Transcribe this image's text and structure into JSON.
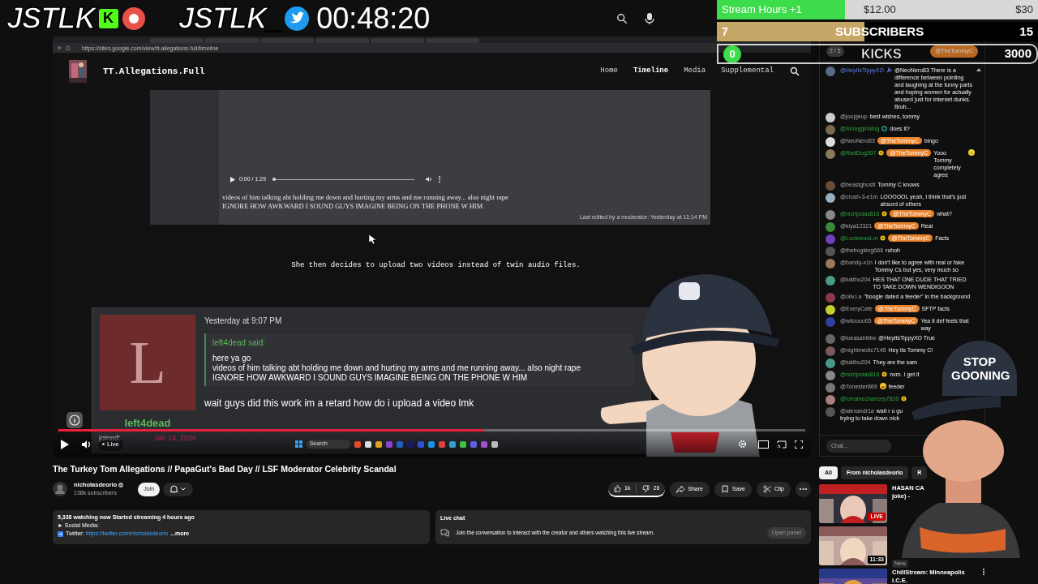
{
  "overlay": {
    "logo_1": "JSTLK",
    "kick_badge": "K",
    "logo_2": "JSTLK_",
    "timer": "00:48:20",
    "cap_text": "STOP GOONING",
    "goals": [
      {
        "kind": "bar",
        "label": "Stream Hours +1",
        "current": "$12.00",
        "target": "$30",
        "level": 0.4
      },
      {
        "kind": "count",
        "label": "SUBSCRIBERS",
        "current": "7",
        "target": "15",
        "level": 0.46
      },
      {
        "kind": "pill",
        "label": "KICKS",
        "current": "0",
        "target": "3000",
        "level": 0
      }
    ]
  },
  "browser": {
    "url": "https://sites.google.com/view/tt-allegations-full/timeline"
  },
  "site": {
    "title": "TT.Allegations.Full",
    "nav": [
      {
        "label": "Home",
        "selected": false
      },
      {
        "label": "Timeline",
        "selected": true
      },
      {
        "label": "Media",
        "selected": false
      },
      {
        "label": "Supplemental",
        "selected": false
      }
    ]
  },
  "audio_post": {
    "time": "0:00 / 1:29",
    "level": 0,
    "lines": [
      "videos of him talking abt holding me down and hurting my arms and me running away... also night rape",
      "IGNORE HOW AWKWARD I SOUND GUYS IMAGINE BEING ON THE PHONE W HIM"
    ],
    "edit_note": "Last edited by a moderator: Yesterday at 11:14 PM"
  },
  "caption": "She then decides to upload two videos instead of twin audio files.",
  "forum_post": {
    "avatar_letter": "L",
    "username": "left4dead",
    "joined_label": "joined:",
    "joined_date": "Jan 14, 2026",
    "time": "Yesterday at 9:07 PM",
    "quote_author": "left4dead said:",
    "quote_lines": [
      "here ya go",
      "videos of him talking abt holding me down and hurting my arms and me running away... also night rape",
      "IGNORE HOW AWKWARD I SOUND GUYS IMAGINE BEING ON THE PHONE W HIM"
    ],
    "reply": "wait guys did this work im a retard how do i upload a video lmk"
  },
  "player": {
    "level": 0.57,
    "live_label": "Live",
    "taskbar_search": "Search"
  },
  "video": {
    "title": "The Turkey Tom Allegations // PapaGut's Bad Day // LSF Moderator Celebrity Scandal",
    "channel": "nicholasdeorio",
    "subscribers": "138k subscribers",
    "join": "Join",
    "likes": "1k",
    "dislikes": "26",
    "actions": [
      {
        "kind": "share",
        "label": "Share"
      },
      {
        "kind": "save",
        "label": "Save"
      },
      {
        "kind": "clip",
        "label": "Clip"
      }
    ]
  },
  "description": {
    "stats": "5,338 watching now  Started streaming 4 hours ago",
    "social": "► Social Media:",
    "twitter_label": "Twitter:",
    "link": "https://twitter.com/nicholasdeorio",
    "more": "...more"
  },
  "live_chat_card": {
    "title": "Live chat",
    "text": "Join the conversation to interact with the creator and others watching this live stream.",
    "button": "Open panel"
  },
  "chat": {
    "counter": "2 / 5",
    "pinned": "@TheTommyC",
    "placeholder": "Chat...",
    "messages": [
      {
        "user": "@HeyItsTippyXO",
        "kind": "moderator",
        "badge": {
          "kind": "wrench"
        },
        "text": "@NeoNero83 There is a difference between pointing and laughing at the funny parts and hoping women for actually abused just for internet dunks. Bruh..."
      },
      {
        "user": "@joopjeup",
        "kind": "viewer",
        "text": "best wishes, tommy"
      },
      {
        "user": "@SmogginMog",
        "kind": "member",
        "badge": {
          "kind": "ring"
        },
        "text": "does it?"
      },
      {
        "user": "@NeoNero83",
        "kind": "viewer",
        "mention": "@TheTommyC",
        "text": "bingo"
      },
      {
        "user": "@RedDog307",
        "kind": "member",
        "badge": {
          "kind": "star"
        },
        "mention": "@TheTommyC",
        "text": "Yooo Tommy completely agree",
        "emojis": [
          {
            "kind": "smile"
          }
        ]
      },
      {
        "user": "@beastghostt",
        "kind": "viewer",
        "text": "Tommy C knows"
      },
      {
        "user": "@crush-3-e1m",
        "kind": "viewer",
        "text": "LOOOOOL yeah, I think that's just absurd of others"
      },
      {
        "user": "@nicripolas816",
        "kind": "member",
        "badge": {
          "kind": "star"
        },
        "mention": "@TheTommyC",
        "text": "what?"
      },
      {
        "user": "@kiya12321",
        "kind": "viewer",
        "mention": "@TheTommyC",
        "text": "Real"
      },
      {
        "user": "@Lockwood.m",
        "kind": "member",
        "badge": {
          "kind": "star"
        },
        "mention": "@TheTommyC",
        "text": "Facts"
      },
      {
        "user": "@thebogking666",
        "kind": "viewer",
        "text": "ruhoh"
      },
      {
        "user": "@bandy-x1n",
        "kind": "viewer",
        "text": "I don't like to agree with real or fake Tommy Cs but yes, very much so"
      },
      {
        "user": "@lukthu204",
        "kind": "viewer",
        "text": "HES THAT ONE DUDE THAT TRIED TO TAKE DOWN WENDIGOON"
      },
      {
        "user": "@oliv.i.a",
        "kind": "viewer",
        "text": "\"boogie dated a feeder\" in the background"
      },
      {
        "user": "@EveryCafe",
        "kind": "viewer",
        "mention": "@TheTommyC",
        "text": "SFTP facts"
      },
      {
        "user": "@wiloooo05",
        "kind": "viewer",
        "mention": "@TheTommyC",
        "text": "Yea it def feels that way"
      },
      {
        "user": "@lueasahibtw",
        "kind": "viewer",
        "text": "@HeyItsTippyXO True"
      },
      {
        "user": "@nightmedic7145",
        "kind": "viewer",
        "text": "Hey its Tommy C!"
      },
      {
        "user": "@lukthu204",
        "kind": "viewer",
        "text": "They are the sam"
      },
      {
        "user": "@nicripolas816",
        "kind": "member",
        "badge": {
          "kind": "star"
        },
        "text": "nvm. I get it"
      },
      {
        "user": "@Tonester869",
        "kind": "viewer",
        "emojis": [
          {
            "kind": "laugh"
          }
        ],
        "text": "feeder"
      },
      {
        "user": "@lorrainechancey7826",
        "kind": "member",
        "badge": {
          "kind": "star"
        }
      },
      {
        "user": "@alexandr1a",
        "kind": "viewer",
        "text": "wait r u gu",
        "more": "trying to take down nick"
      }
    ]
  },
  "recommended": {
    "chips": [
      {
        "label": "All",
        "selected": true
      },
      {
        "label": "From nicholasdeorio",
        "selected": false
      },
      {
        "label": "R",
        "selected": false
      }
    ],
    "videos": [
      {
        "kind": "live",
        "badge": "LIVE",
        "title_lines": [
          "HASAN CA",
          "joke) -"
        ]
      },
      {
        "kind": "duration",
        "duration": "11:33",
        "tag": "New"
      },
      {
        "kind": "plain",
        "title": "ChillStream: Minneapolis I.C.E."
      }
    ]
  }
}
